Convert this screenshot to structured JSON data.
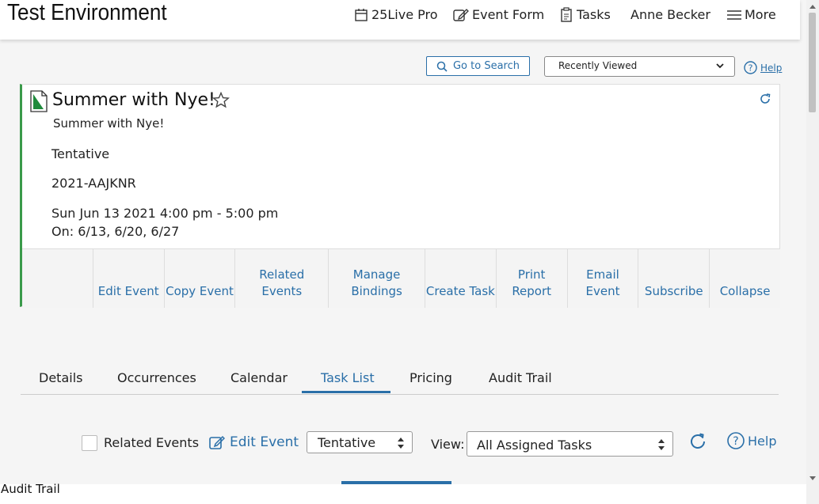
{
  "header": {
    "app_title": "Test Environment",
    "nav_25live": "25Live Pro",
    "nav_event_form": "Event Form",
    "nav_tasks": "Tasks",
    "nav_user": "Anne Becker",
    "nav_more": "More"
  },
  "search_bar": {
    "go_to_search": "Go to Search",
    "recently_viewed": "Recently Viewed",
    "help": "Help"
  },
  "event": {
    "title": "Summer with Nye!",
    "name": "Summer with Nye!",
    "state": "Tentative",
    "reference": "2021-AAJKNR",
    "date_time": "Sun Jun 13 2021 4:00 pm - 5:00 pm",
    "occurrences": "On: 6/13, 6/20, 6/27"
  },
  "actions": [
    "",
    "Edit Event",
    "Copy Event",
    "Related Events",
    "Manage Bindings",
    "Create Task",
    "Print Report",
    "Email Event",
    "Subscribe",
    "Collapse"
  ],
  "tabs": [
    "Details",
    "Occurrences",
    "Calendar",
    "Task List",
    "Pricing",
    "Audit Trail"
  ],
  "active_tab": "Task List",
  "task_toolbar": {
    "related_events": "Related Events",
    "edit_event": "Edit Event",
    "state_value": "Tentative",
    "view_label": "View:",
    "view_value": "All Assigned Tasks",
    "help": "Help"
  },
  "footer": {
    "audit_trail": "Audit Trail"
  },
  "colors": {
    "accent": "#2a6fa8",
    "status_bar": "#3a9a4a"
  }
}
